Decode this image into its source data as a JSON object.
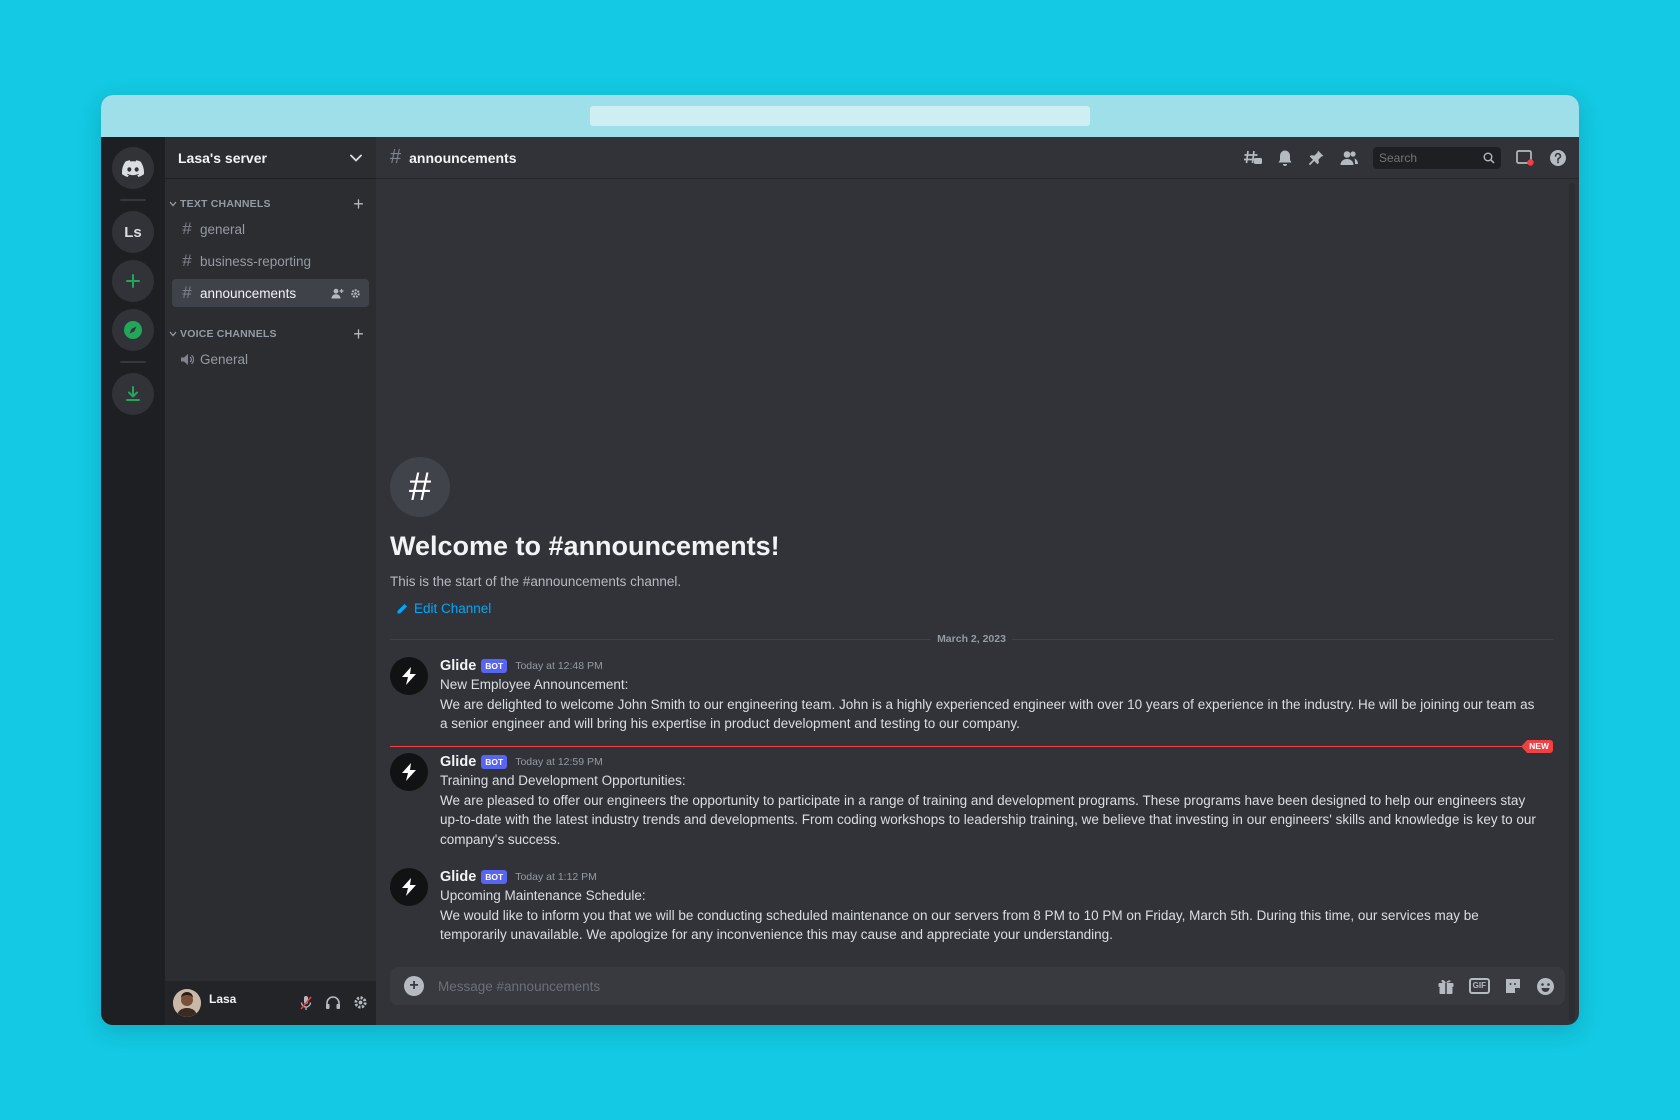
{
  "server": {
    "name": "Lasa's server",
    "rail_initials": "Ls"
  },
  "categories": {
    "text": "TEXT CHANNELS",
    "voice": "VOICE CHANNELS"
  },
  "text_channels": [
    {
      "name": "general"
    },
    {
      "name": "business-reporting"
    },
    {
      "name": "announcements"
    }
  ],
  "voice_channels": [
    {
      "name": "General"
    }
  ],
  "user": {
    "name": "Lasa"
  },
  "topbar": {
    "channel": "announcements",
    "search_placeholder": "Search"
  },
  "welcome": {
    "title": "Welcome to #announcements!",
    "subtitle": "This is the start of the #announcements channel.",
    "edit_label": "Edit Channel"
  },
  "date_divider": "March 2, 2023",
  "new_marker": "NEW",
  "messages": [
    {
      "author": "Glide",
      "badge": "BOT",
      "time": "Today at 12:48 PM",
      "line1": "New Employee Announcement:",
      "line2": "We are delighted to welcome John Smith to our engineering team. John is a highly experienced engineer with over 10 years of experience in the industry. He will be joining our team as a senior engineer and will bring his expertise in product development and testing to our company."
    },
    {
      "author": "Glide",
      "badge": "BOT",
      "time": "Today at 12:59 PM",
      "line1": "Training and Development Opportunities:",
      "line2": "We are pleased to offer our engineers the opportunity to participate in a range of training and development programs. These programs have been designed to help our engineers stay up-to-date with the latest industry trends and developments. From coding workshops to leadership training, we believe that investing in our engineers' skills and knowledge is key to our company's success."
    },
    {
      "author": "Glide",
      "badge": "BOT",
      "time": "Today at 1:12 PM",
      "line1": "Upcoming Maintenance Schedule:",
      "line2": "We would like to inform you that we will be conducting scheduled maintenance on our servers from 8 PM to 10 PM on Friday, March 5th. During this time, our services may be temporarily unavailable. We apologize for any inconvenience this may cause and appreciate your understanding."
    }
  ],
  "composer": {
    "placeholder": "Message #announcements",
    "gif_label": "GIF"
  },
  "colors": {
    "background": "#13c9e3",
    "accent": "#5865f2",
    "link": "#00a8fc",
    "new_marker": "#f23f42",
    "green": "#23a55a"
  }
}
